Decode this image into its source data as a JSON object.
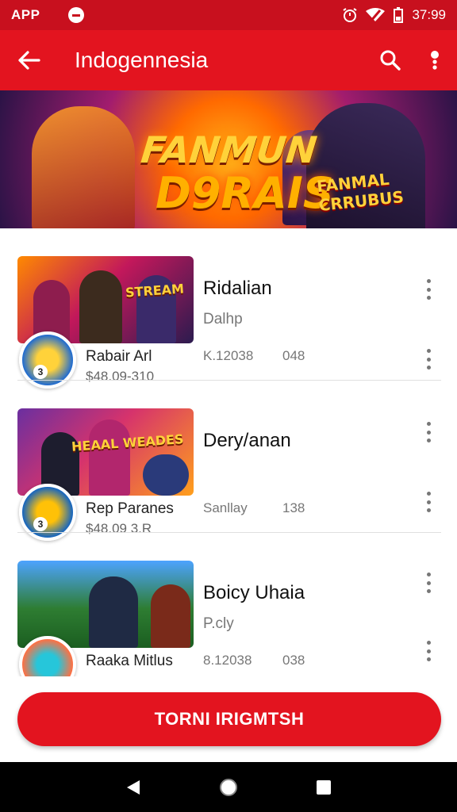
{
  "status_bar": {
    "app_label": "APP",
    "time": "37:99"
  },
  "app_bar": {
    "title": "Indogennesia",
    "back_icon": "arrow-left-icon",
    "search_icon": "search-icon",
    "more_icon": "more-vert-icon"
  },
  "banner": {
    "line1": "FANMUN",
    "line2": "D9RAIS",
    "tag": "FANMAL CRRUBUS"
  },
  "games": [
    {
      "name": "Ridalian",
      "sub": "Dalhp",
      "label": "Rabair Arl",
      "price": "$48.09-310",
      "stat1": "K.12038",
      "stat2": "048",
      "badge_number": "3",
      "thumb_caption": "STREAM"
    },
    {
      "name": "Dery/anan",
      "sub": "",
      "label": "Rep Paranes",
      "price": "$48.09 3.R",
      "stat1": "Sanllay",
      "stat2": "138",
      "badge_number": "3",
      "thumb_caption": "HEAAL WEADES"
    },
    {
      "name": "Boicy Uhaia",
      "sub": "P.cly",
      "label": "Raaka Mitlus",
      "price": "",
      "stat1": "8.12038",
      "stat2": "038",
      "badge_number": "",
      "thumb_caption": ""
    }
  ],
  "cta": {
    "label": "TORNI IRIGMTSH"
  },
  "nav": {
    "back_icon": "back-triangle-icon",
    "home_icon": "home-circle-icon",
    "recents_icon": "recents-square-icon"
  },
  "colors": {
    "primary": "#e3141f",
    "status": "#c8101e"
  }
}
